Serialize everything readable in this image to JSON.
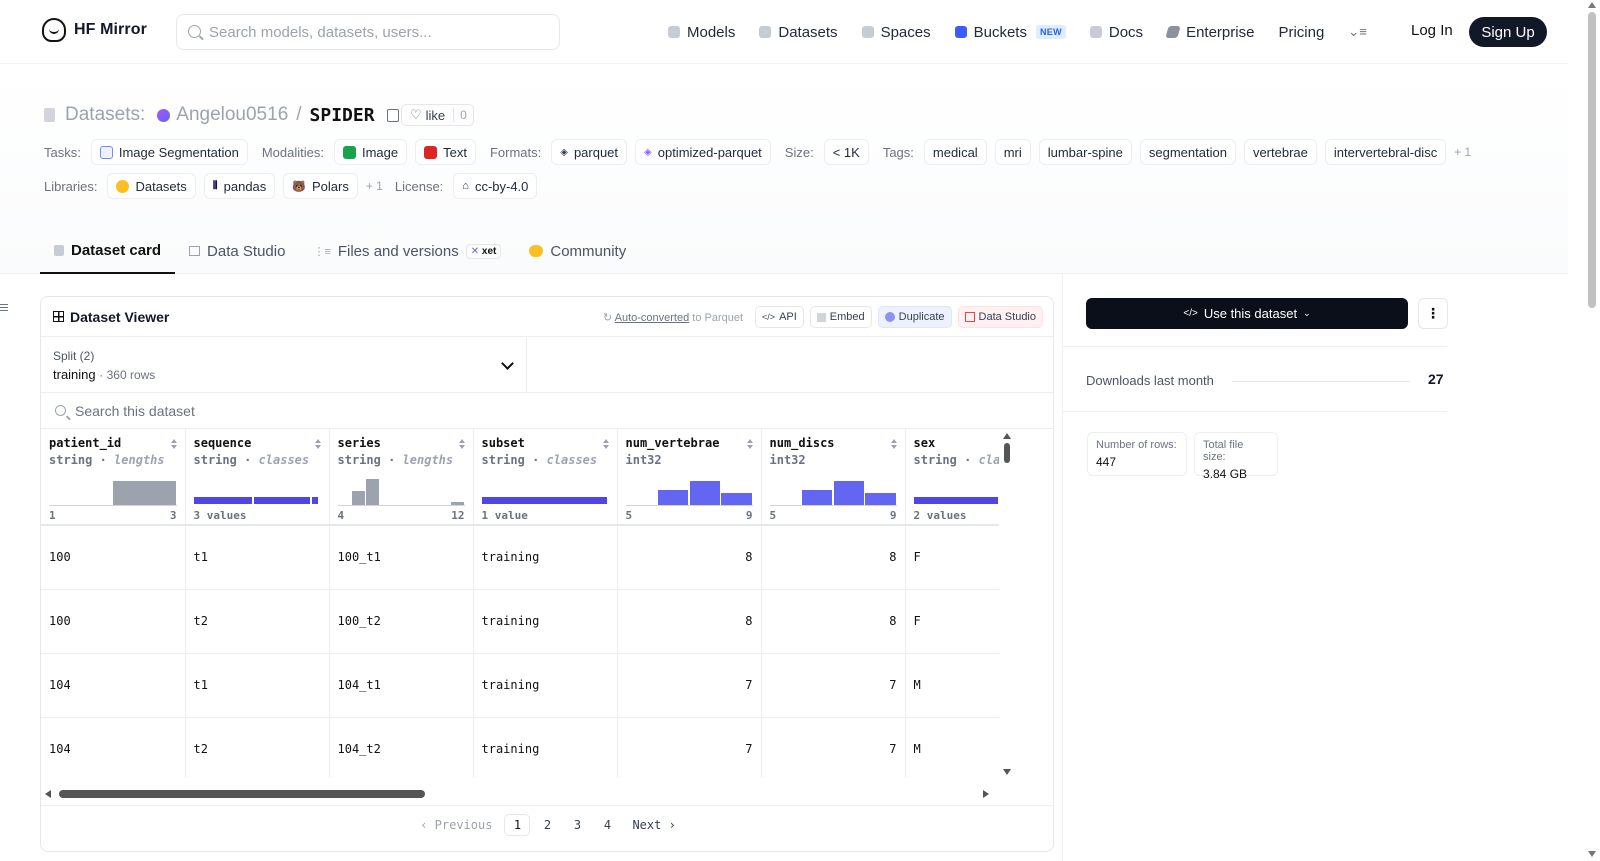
{
  "nav": {
    "brand": "HF Mirror",
    "search_placeholder": "Search models, datasets, users...",
    "links": [
      {
        "label": "Models",
        "icon": "models-icon",
        "color": "#9ca3af"
      },
      {
        "label": "Datasets",
        "icon": "datasets-icon",
        "color": "#9ca3af"
      },
      {
        "label": "Spaces",
        "icon": "spaces-icon",
        "color": "#9ca3af"
      },
      {
        "label": "Buckets",
        "icon": "buckets-icon",
        "color": "#3b5bff",
        "badge": "NEW"
      },
      {
        "label": "Docs",
        "icon": "docs-icon",
        "color": "#9ca3af"
      },
      {
        "label": "Enterprise",
        "icon": "enterprise-icon",
        "color": "#6b7280"
      },
      {
        "label": "Pricing"
      }
    ],
    "login": "Log In",
    "signup": "Sign Up"
  },
  "header": {
    "prefix": "Datasets:",
    "org": "Angelou0516",
    "sep": "/",
    "name": "SPIDER",
    "like_label": "like",
    "like_count": "0"
  },
  "meta": {
    "tasks_label": "Tasks:",
    "tasks": [
      "Image Segmentation"
    ],
    "modalities_label": "Modalities:",
    "modalities": [
      "Image",
      "Text"
    ],
    "formats_label": "Formats:",
    "formats": [
      "parquet",
      "optimized-parquet"
    ],
    "size_label": "Size:",
    "size": "< 1K",
    "tags_label": "Tags:",
    "tags": [
      "medical",
      "mri",
      "lumbar-spine",
      "segmentation",
      "vertebrae",
      "intervertebral-disc"
    ],
    "tags_more": "+ 1",
    "libraries_label": "Libraries:",
    "libraries": [
      "Datasets",
      "pandas",
      "Polars"
    ],
    "libraries_more": "+ 1",
    "license_label": "License:",
    "license": "cc-by-4.0"
  },
  "tabs": [
    "Dataset card",
    "Data Studio",
    "Files and versions",
    "Community"
  ],
  "tabs_xet": "xet",
  "viewer": {
    "title": "Dataset Viewer",
    "autoconv_link": "Auto-converted",
    "autoconv_rest": "to Parquet",
    "api": "API",
    "embed": "Embed",
    "duplicate": "Duplicate",
    "data_studio": "Data Studio",
    "split_label": "Split (2)",
    "split_value": "training",
    "split_rows": "360 rows",
    "search_placeholder": "Search this dataset",
    "columns": [
      {
        "name": "patient_id",
        "type": "string",
        "stat": "lengths",
        "min": "1",
        "max": "3",
        "hist": [
          0.02,
          0.85
        ],
        "hist_color": "#9ca3af"
      },
      {
        "name": "sequence",
        "type": "string",
        "stat": "classes",
        "min": "3 values",
        "max": "",
        "classes": [
          0.48,
          0.45,
          0.07
        ],
        "hist_color": "#4f46e5"
      },
      {
        "name": "series",
        "type": "string",
        "stat": "lengths",
        "min": "4",
        "max": "12",
        "hist": [
          0.05,
          0.5,
          0.9,
          0,
          0,
          0,
          0,
          0.03,
          0.12
        ],
        "hist_color": "#9ca3af"
      },
      {
        "name": "subset",
        "type": "string",
        "stat": "classes",
        "min": "1 value",
        "max": "",
        "classes": [
          1.0
        ],
        "hist_color": "#4f46e5"
      },
      {
        "name": "num_vertebrae",
        "type": "int32",
        "stat": "",
        "min": "5",
        "max": "9",
        "hist": [
          0.02,
          0.55,
          0.85,
          0.45
        ],
        "hist_color": "#6366f1"
      },
      {
        "name": "num_discs",
        "type": "int32",
        "stat": "",
        "min": "5",
        "max": "9",
        "hist": [
          0.02,
          0.55,
          0.85,
          0.45
        ],
        "hist_color": "#6366f1"
      },
      {
        "name": "sex",
        "type": "string",
        "stat": "clas",
        "min": "2 values",
        "max": "",
        "classes": [
          0.62,
          0.38
        ],
        "hist_color": "#4f46e5"
      }
    ],
    "rows": [
      [
        "100",
        "t1",
        "100_t1",
        "training",
        "8",
        "8",
        "F"
      ],
      [
        "100",
        "t2",
        "100_t2",
        "training",
        "8",
        "8",
        "F"
      ],
      [
        "104",
        "t1",
        "104_t1",
        "training",
        "7",
        "7",
        "M"
      ],
      [
        "104",
        "t2",
        "104_t2",
        "training",
        "7",
        "7",
        "M"
      ]
    ],
    "pager": {
      "prev": "Previous",
      "pages": [
        "1",
        "2",
        "3",
        "4"
      ],
      "current": "1",
      "next": "Next"
    }
  },
  "side": {
    "use_button": "Use this dataset",
    "downloads_label": "Downloads last month",
    "downloads_value": "27",
    "rows_label": "Number of rows:",
    "rows_value": "447",
    "size_label": "Total file size:",
    "size_value": "3.84 GB"
  }
}
